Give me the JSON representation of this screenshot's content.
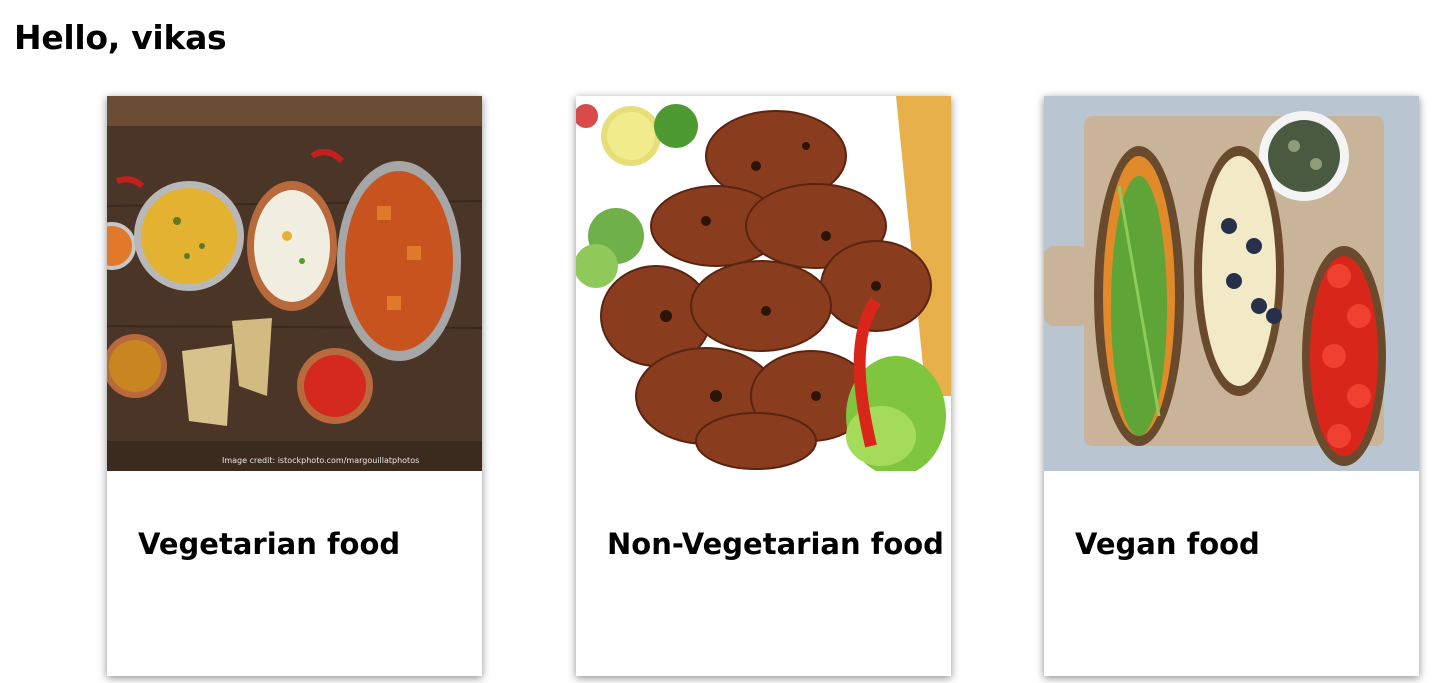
{
  "header": {
    "greeting": "Hello, vikas"
  },
  "cards": [
    {
      "title": "Vegetarian food",
      "image": "vegetarian-dishes-photo",
      "image_credit": "Image credit: istockphoto.com/margouillatphotos"
    },
    {
      "title": "Non-Vegetarian food",
      "image": "grilled-kebab-photo"
    },
    {
      "title": "Vegan food",
      "image": "vegan-toasts-photo"
    }
  ]
}
